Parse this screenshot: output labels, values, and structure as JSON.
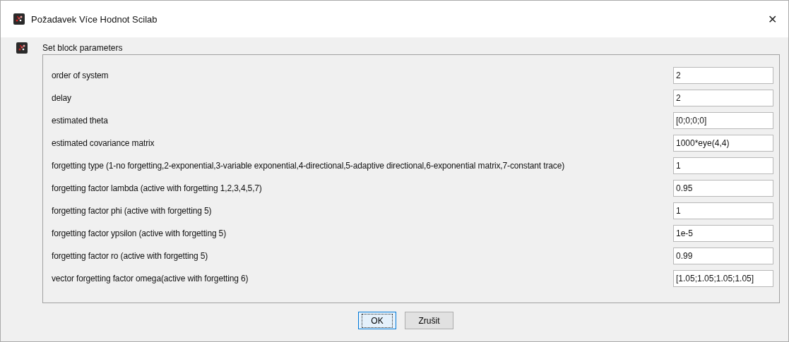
{
  "window": {
    "title": "Požadavek Více Hodnot Scilab",
    "close": "✕"
  },
  "header": "Set block parameters",
  "fields": [
    {
      "label": "order of system",
      "value": "2"
    },
    {
      "label": "delay",
      "value": "2"
    },
    {
      "label": "estimated theta",
      "value": "[0;0;0;0]"
    },
    {
      "label": "estimated covariance matrix",
      "value": "1000*eye(4,4)"
    },
    {
      "label": "forgetting type (1-no forgetting,2-exponential,3-variable exponential,4-directional,5-adaptive directional,6-exponential matrix,7-constant trace)",
      "value": "1"
    },
    {
      "label": "forgetting factor lambda (active with forgetting 1,2,3,4,5,7)",
      "value": "0.95"
    },
    {
      "label": "forgetting factor phi (active with forgetting 5)",
      "value": "1"
    },
    {
      "label": "forgetting factor ypsilon (active with forgetting 5)",
      "value": "1e-5"
    },
    {
      "label": "forgetting factor ro (active with forgetting 5)",
      "value": "0.99"
    },
    {
      "label": "vector forgetting factor omega(active with forgetting 6)",
      "value": "[1.05;1.05;1.05;1.05]"
    }
  ],
  "buttons": [
    {
      "label": "OK",
      "focused": true
    },
    {
      "label": "Zrušit",
      "focused": false
    }
  ]
}
